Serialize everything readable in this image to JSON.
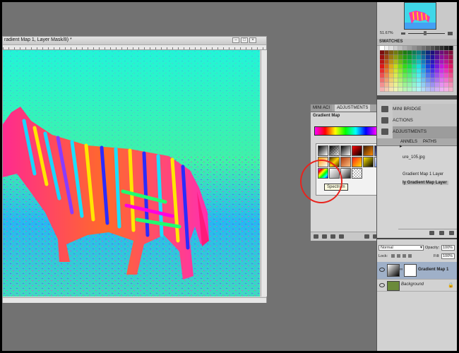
{
  "document": {
    "title": "radient Map 1, Layer Mask/8) *"
  },
  "navigator": {
    "zoom": "51.67%"
  },
  "swatches": {
    "title": "SWATCHES"
  },
  "side_panels": [
    {
      "label": "MINI BRIDGE",
      "icon": "mini-bridge-icon"
    },
    {
      "label": "ACTIONS",
      "icon": "actions-icon"
    },
    {
      "label": "ADJUSTMENTS",
      "icon": "adjustments-icon"
    }
  ],
  "adjustments_panel": {
    "tabs": [
      "MINI ACI",
      "ADJUSTMENTS"
    ],
    "title": "Gradient Map",
    "tooltip": "Spectrum",
    "annotation_color": "#e8231d"
  },
  "history_panel": {
    "tabs": [
      "ANNELS",
      "PATHS"
    ],
    "items": [
      "ure_105.jpg",
      "Gradient Map 1 Layer",
      "ly Gradient Map Layer"
    ]
  },
  "layers_panel": {
    "blend_mode": "Normal",
    "opacity_label": "Opacity:",
    "opacity_value": "100%",
    "lock_label": "Lock:",
    "fill_label": "Fill:",
    "fill_value": "100%",
    "layers": [
      {
        "name": "Gradient Map 1"
      },
      {
        "name": "Background"
      }
    ]
  }
}
